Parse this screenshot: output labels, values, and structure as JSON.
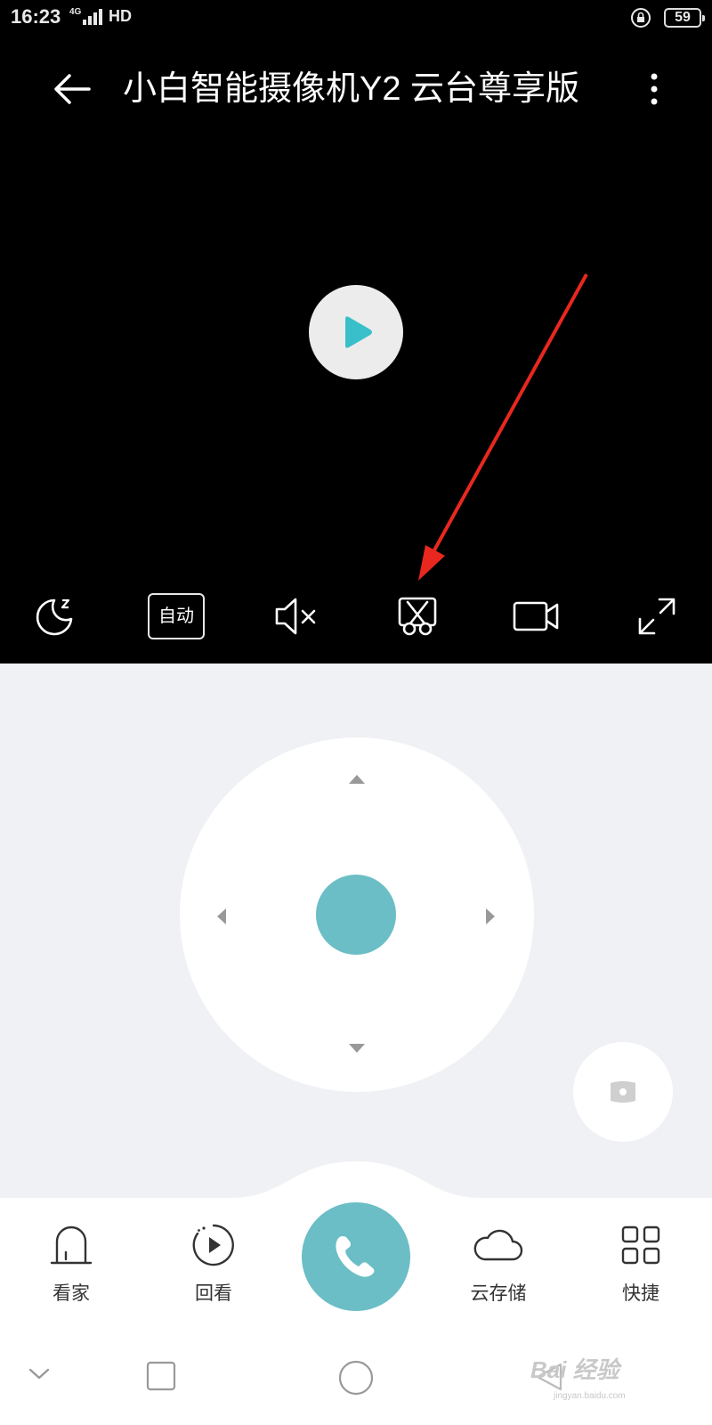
{
  "status_bar": {
    "time": "16:23",
    "network": "4G",
    "hd": "HD",
    "battery": "59"
  },
  "header": {
    "title": "小白智能摄像机Y2 云台尊享版"
  },
  "video": {
    "state": "paused",
    "controls": {
      "auto_label": "自动"
    }
  },
  "bottom_nav": {
    "items": [
      {
        "label": "看家",
        "icon": "home-watch-icon"
      },
      {
        "label": "回看",
        "icon": "playback-icon"
      },
      {
        "label": "云存储",
        "icon": "cloud-icon"
      },
      {
        "label": "快捷",
        "icon": "grid-icon"
      }
    ]
  },
  "watermark": {
    "text": "Bai 经验",
    "sub": "jingyan.baidu.com"
  },
  "colors": {
    "accent": "#6bbec5",
    "annotation_arrow": "#e8281e",
    "video_bg": "#000000",
    "ptz_bg": "#eff1f4"
  }
}
